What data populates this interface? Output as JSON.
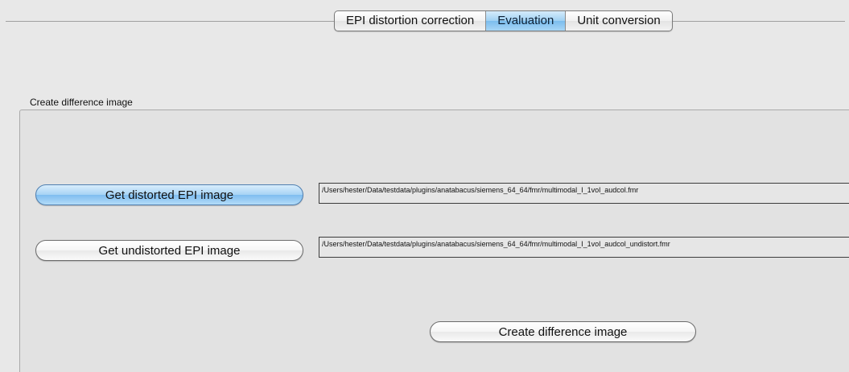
{
  "tabs": [
    {
      "label": "EPI distortion correction",
      "active": false
    },
    {
      "label": "Evaluation",
      "active": true
    },
    {
      "label": "Unit conversion",
      "active": false
    }
  ],
  "group": {
    "title": "Create difference image"
  },
  "buttons": {
    "get_distorted": "Get distorted EPI image",
    "get_undistorted": "Get undistorted EPI image",
    "create_difference": "Create difference image"
  },
  "paths": {
    "distorted": "/Users/hester/Data/testdata/plugins/anatabacus/siemens_64_64/fmr/multimodal_I_1vol_audcol.fmr",
    "undistorted": "/Users/hester/Data/testdata/plugins/anatabacus/siemens_64_64/fmr/multimodal_I_1vol_audcol_undistort.fmr"
  },
  "colors": {
    "active_tab": "#9fd0f3",
    "default_button": "#a6d3f5",
    "window_bg": "#e8e8e8"
  }
}
